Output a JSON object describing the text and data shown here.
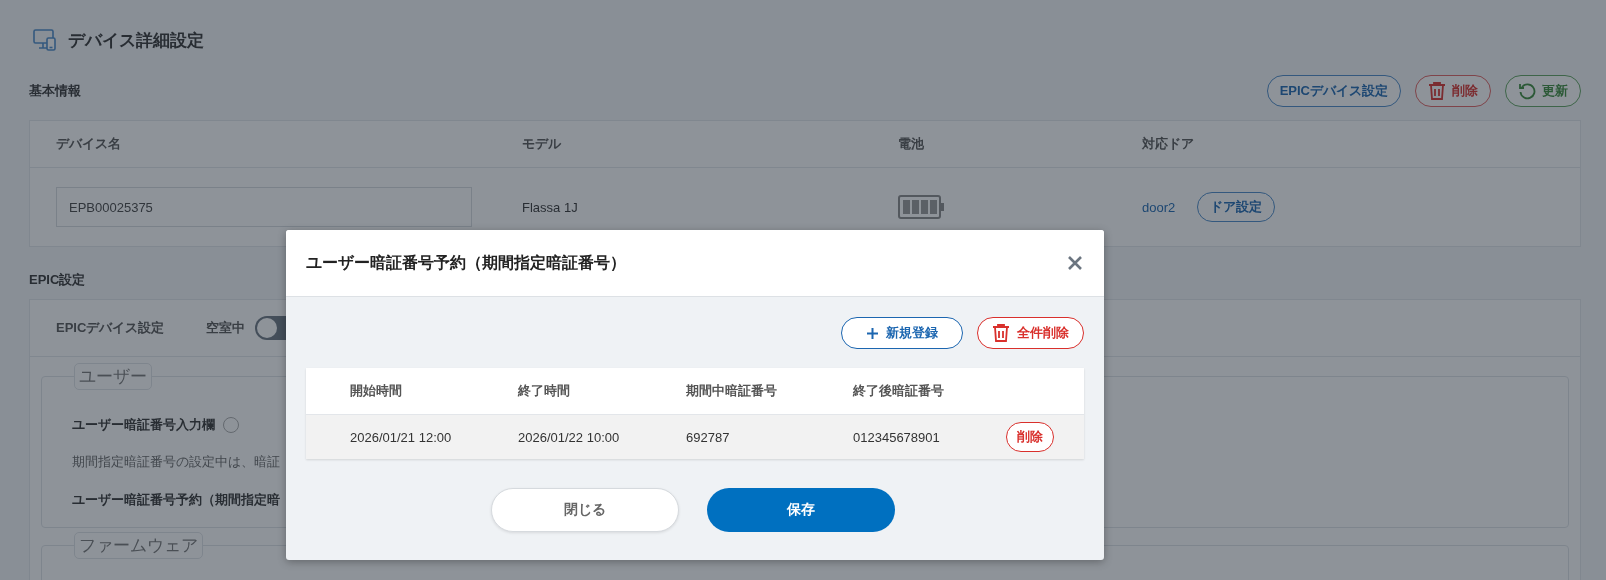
{
  "page": {
    "title": "デバイス詳細設定"
  },
  "basic_info": {
    "heading": "基本情報",
    "actions": [
      {
        "label": "EPICデバイス設定",
        "kind": "settings"
      },
      {
        "label": "削除",
        "kind": "delete"
      },
      {
        "label": "更新",
        "kind": "refresh"
      }
    ],
    "columns": [
      "デバイス名",
      "モデル",
      "電池",
      "対応ドア"
    ],
    "device_name": "EPB00025375",
    "model": "Flassa 1J",
    "door": "door2",
    "door_button": "ドア設定"
  },
  "epic_settings": {
    "heading": "EPIC設定",
    "device_setting_label": "EPICデバイス設定",
    "vacancy_label": "空室中",
    "vacancy_toggle": {
      "on": false
    },
    "user_section": {
      "legend": "ユーザー",
      "pin_input_label": "ユーザー暗証番号入力欄",
      "pin_note": "期間指定暗証番号の設定中は、暗証",
      "reservation_label": "ユーザー暗証番号予約（期間指定暗"
    },
    "firmware_section": {
      "legend": "ファームウェア"
    }
  },
  "dialog": {
    "title": "ユーザー暗証番号予約（期間指定暗証番号）",
    "actions": [
      {
        "label": "新規登録",
        "kind": "add"
      },
      {
        "label": "全件削除",
        "kind": "delete"
      }
    ],
    "table": {
      "columns": [
        "開始時間",
        "終了時間",
        "期間中暗証番号",
        "終了後暗証番号"
      ],
      "rows": [
        {
          "cells": [
            "2026/01/21 12:00",
            "2026/01/22 10:00",
            "692787",
            "012345678901"
          ],
          "delete": "削除"
        }
      ]
    },
    "footer": [
      {
        "label": "閉じる",
        "kind": "secondary"
      },
      {
        "label": "保存",
        "kind": "primary"
      }
    ]
  }
}
